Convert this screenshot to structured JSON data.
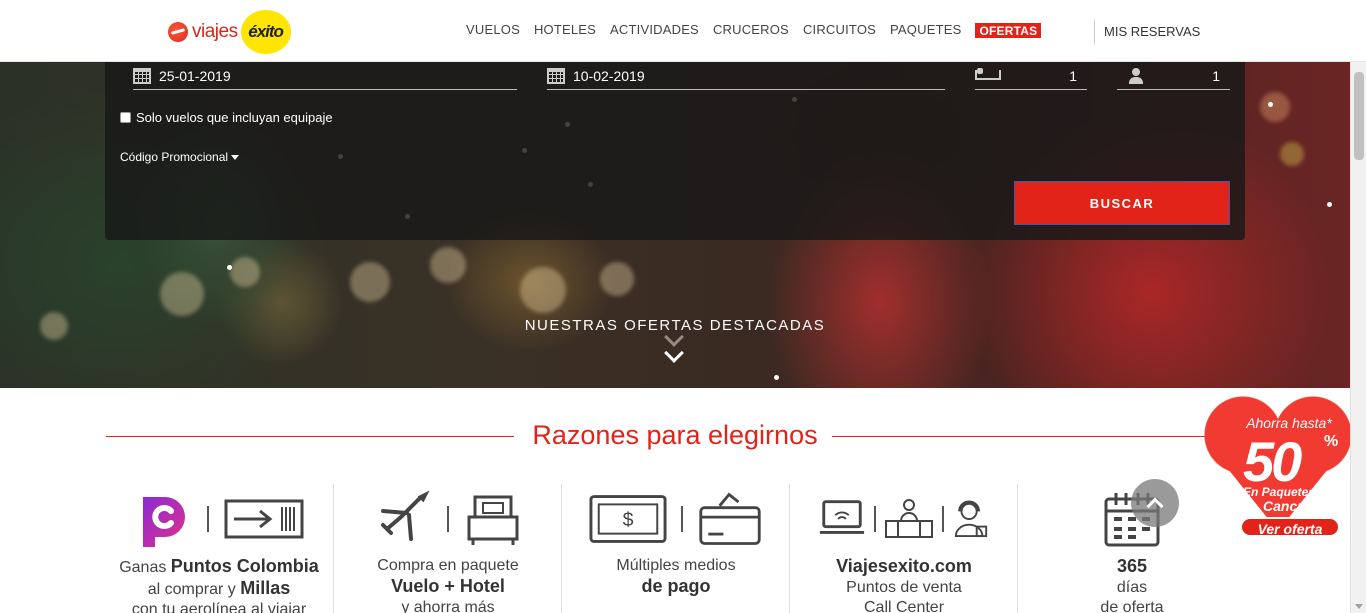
{
  "header": {
    "logo_text": "viajes",
    "logo_brand": "éxito",
    "nav": [
      "VUELOS",
      "HOTELES",
      "ACTIVIDADES",
      "CRUCEROS",
      "CIRCUITOS",
      "PAQUETES"
    ],
    "offers": "OFERTAS",
    "reservations": "MIS RESERVAS"
  },
  "search": {
    "departure_date": "25-01-2019",
    "return_date": "10-02-2019",
    "rooms": "1",
    "passengers": "1",
    "baggage_checkbox": "Solo vuelos que incluyan equipaje",
    "promo_code": "Código Promocional",
    "search_button": "BUSCAR"
  },
  "hero": {
    "featured": "NUESTRAS OFERTAS DESTACADAS"
  },
  "reasons": {
    "title": "Razones para elegirnos",
    "items": [
      {
        "l1a": "Ganas ",
        "l1b": "Puntos Colombia",
        "l2a": "al comprar y ",
        "l2b": "Millas",
        "l3": "con tu aerolínea al viajar"
      },
      {
        "l1": "Compra en paquete",
        "l2": "Vuelo + Hotel",
        "l3": "y ahorra más"
      },
      {
        "l1": "Múltiples medios",
        "l2": "de pago"
      },
      {
        "l1": "Viajesexito.com",
        "l2": "Puntos de venta",
        "l3": "Call Center"
      },
      {
        "l1": "365",
        "l2": "días",
        "l3": "de oferta"
      }
    ]
  },
  "promo_badge": {
    "line1": "Ahorra hasta*",
    "value": "50",
    "percent": "%",
    "line2": "En Paquetes a",
    "line3": "Cancún",
    "cta": "Ver oferta"
  },
  "colors": {
    "accent": "#e2231a",
    "brand_yellow": "#ffe500"
  }
}
